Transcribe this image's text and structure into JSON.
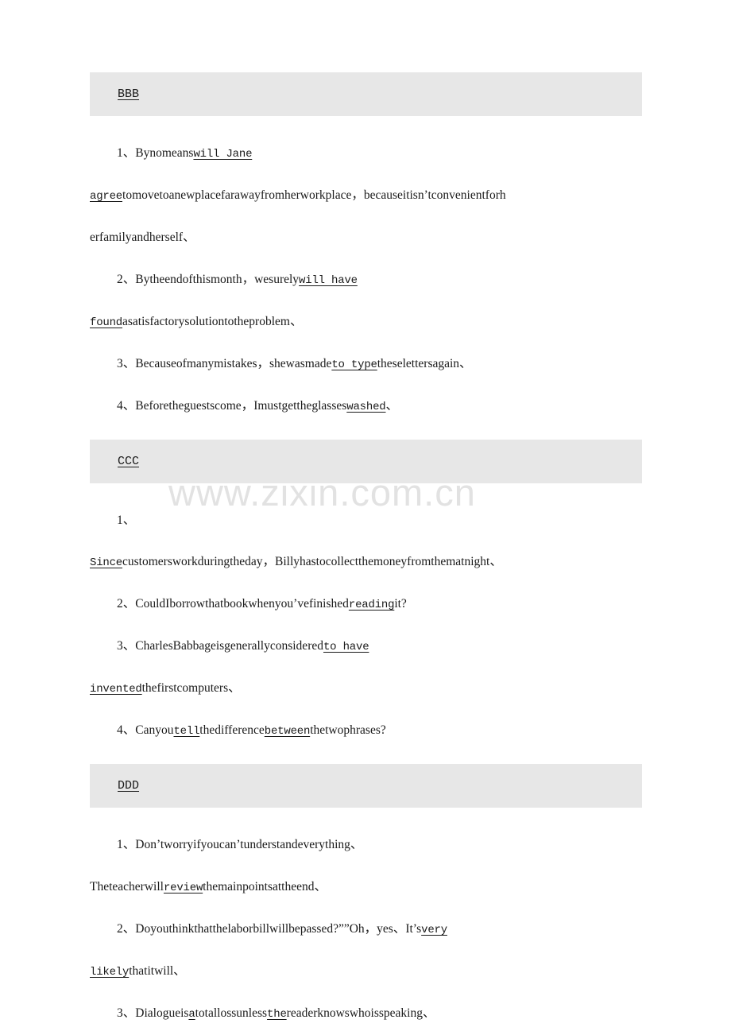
{
  "document": {
    "type": "grammar-answer-key",
    "watermark": "www.zixin.com.cn",
    "background_color": "#ffffff",
    "band_color": "#e7e7e7",
    "text_color": "#1a1a1a"
  },
  "sections": [
    {
      "heading": "BBB ",
      "items": [
        {
          "number": "1、",
          "lines": [
            [
              {
                "text": "Bynomeans",
                "underline": false,
                "mono": false
              },
              {
                "text": "will Jane ",
                "underline": true,
                "mono": true
              }
            ],
            [
              {
                "text": "agree",
                "underline": true,
                "mono": true
              },
              {
                "text": "tomovetoanewplacefarawayfromherworkplace，becauseitisn’tconvenientforh",
                "underline": false,
                "mono": false
              }
            ],
            [
              {
                "text": "erfamilyandherself、",
                "underline": false,
                "mono": false
              }
            ]
          ]
        },
        {
          "number": "2、",
          "lines": [
            [
              {
                "text": "Bytheendofthismonth，wesurely",
                "underline": false,
                "mono": false
              },
              {
                "text": "will have ",
                "underline": true,
                "mono": true
              }
            ],
            [
              {
                "text": "found",
                "underline": true,
                "mono": true
              },
              {
                "text": "asatisfactorysolutiontotheproblem、",
                "underline": false,
                "mono": false
              }
            ]
          ]
        },
        {
          "number": "3、",
          "lines": [
            [
              {
                "text": "Becauseofmanymistakes，shewasmade",
                "underline": false,
                "mono": false
              },
              {
                "text": "to type",
                "underline": true,
                "mono": true
              },
              {
                "text": "theselettersagain、",
                "underline": false,
                "mono": false
              }
            ]
          ]
        },
        {
          "number": "4、",
          "lines": [
            [
              {
                "text": "Beforetheguestscome，Imustgettheglasses",
                "underline": false,
                "mono": false
              },
              {
                "text": "washed",
                "underline": true,
                "mono": true
              },
              {
                "text": "、",
                "underline": false,
                "mono": false
              }
            ]
          ]
        }
      ]
    },
    {
      "heading": "CCC ",
      "items": [
        {
          "number": "1、",
          "lines": [
            [],
            [
              {
                "text": "Since",
                "underline": true,
                "mono": true
              },
              {
                "text": "customersworkduringtheday，Billyhastocollectthemoneyfromthematnight、",
                "underline": false,
                "mono": false
              }
            ]
          ]
        },
        {
          "number": "2、",
          "lines": [
            [
              {
                "text": "CouldIborrowthatbookwhenyou’vefinished",
                "underline": false,
                "mono": false
              },
              {
                "text": "reading",
                "underline": true,
                "mono": true
              },
              {
                "text": "it?",
                "underline": false,
                "mono": false
              }
            ]
          ]
        },
        {
          "number": "3、",
          "lines": [
            [
              {
                "text": "CharlesBabbageisgenerallyconsidered",
                "underline": false,
                "mono": false
              },
              {
                "text": "to have ",
                "underline": true,
                "mono": true
              }
            ],
            [
              {
                "text": "invented",
                "underline": true,
                "mono": true
              },
              {
                "text": "thefirstcomputers、",
                "underline": false,
                "mono": false
              }
            ]
          ]
        },
        {
          "number": "4、",
          "lines": [
            [
              {
                "text": "Canyou",
                "underline": false,
                "mono": false
              },
              {
                "text": "tell",
                "underline": true,
                "mono": true
              },
              {
                "text": "thedifference",
                "underline": false,
                "mono": false
              },
              {
                "text": "between",
                "underline": true,
                "mono": true
              },
              {
                "text": "thetwophrases?",
                "underline": false,
                "mono": false
              }
            ]
          ]
        }
      ]
    },
    {
      "heading": "DDD ",
      "items": [
        {
          "number": "1、",
          "lines": [
            [
              {
                "text": "Don’tworryifyoucan’tunderstandeverything、",
                "underline": false,
                "mono": false
              }
            ],
            [
              {
                "text": "Theteacherwill",
                "underline": false,
                "mono": false
              },
              {
                "text": "review",
                "underline": true,
                "mono": true
              },
              {
                "text": "themainpointsattheend、",
                "underline": false,
                "mono": false
              }
            ]
          ]
        },
        {
          "number": "2、",
          "lines": [
            [
              {
                "text": "Doyouthinkthatthelaborbillwillbepassed?””Oh，yes、It’s",
                "underline": false,
                "mono": false
              },
              {
                "text": "very ",
                "underline": true,
                "mono": true
              }
            ],
            [
              {
                "text": "likely",
                "underline": true,
                "mono": true
              },
              {
                "text": "thatitwill、",
                "underline": false,
                "mono": false
              }
            ]
          ]
        },
        {
          "number": "3、",
          "lines": [
            [
              {
                "text": "Dialogueis",
                "underline": false,
                "mono": false
              },
              {
                "text": "a",
                "underline": true,
                "mono": true
              },
              {
                "text": "totallossunless",
                "underline": false,
                "mono": false
              },
              {
                "text": "the",
                "underline": true,
                "mono": true
              },
              {
                "text": "readerknowswhoisspeaking、",
                "underline": false,
                "mono": false
              }
            ]
          ]
        }
      ]
    }
  ]
}
